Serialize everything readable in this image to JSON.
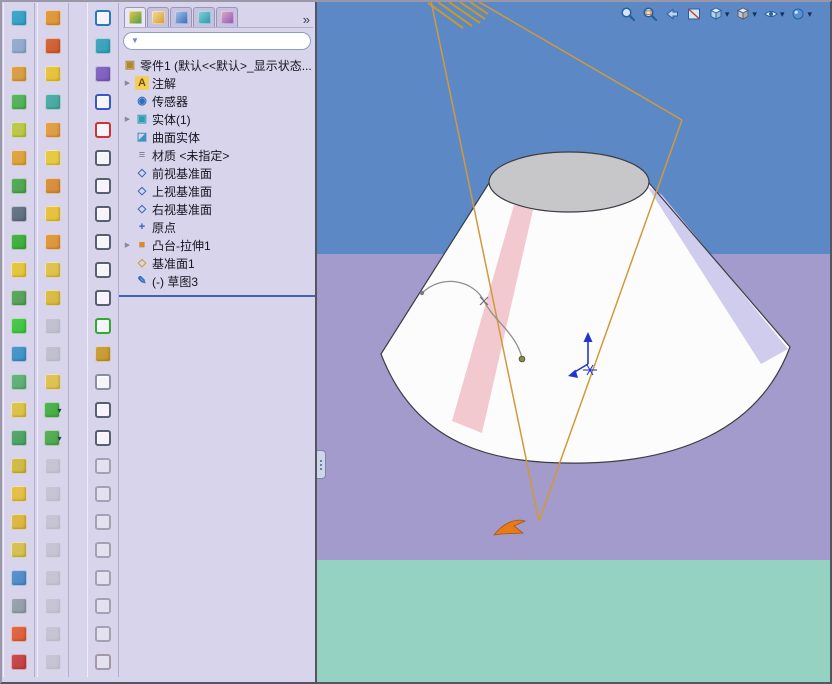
{
  "panel": {
    "overflow_chevron": "»",
    "tabs": [
      {
        "n": "featuremanager",
        "g": "linear-gradient(135deg,#e8c84a,#4c9a4c)"
      },
      {
        "n": "propertymanager",
        "g": "linear-gradient(135deg,#f0e0a0,#d89830)"
      },
      {
        "n": "configurationmanager",
        "g": "linear-gradient(135deg,#a8c4e8,#3868b8)"
      },
      {
        "n": "dimxpertmanager",
        "g": "linear-gradient(135deg,#88d0d8,#2898a8)"
      },
      {
        "n": "displaymanager",
        "g": "linear-gradient(135deg,#e8a8c0,#8858b8)"
      }
    ],
    "filter": {
      "value": "",
      "placeholder": ""
    },
    "tree": {
      "root": {
        "label": "零件1 (默认<<默认>_显示状态...",
        "glyph": "▣",
        "fg": "#b08828"
      },
      "items": [
        {
          "n": "annotations",
          "label": "注解",
          "glyph": "A",
          "fg": "#7a4c00",
          "bg": "#f2cf5a",
          "arrow": 1
        },
        {
          "n": "sensors",
          "label": "传感器",
          "glyph": "◉",
          "fg": "#2f6fc0"
        },
        {
          "n": "solid-bodies",
          "label": "实体(1)",
          "glyph": "▣",
          "fg": "#2f9fb0",
          "arrow": 1
        },
        {
          "n": "surface-bodies",
          "label": "曲面实体",
          "glyph": "◪",
          "fg": "#4090c0"
        },
        {
          "n": "material",
          "label": "材质 <未指定>",
          "glyph": "≡",
          "fg": "#6f7786"
        },
        {
          "n": "front-plane",
          "label": "前视基准面",
          "glyph": "◇",
          "fg": "#3868c0"
        },
        {
          "n": "top-plane",
          "label": "上视基准面",
          "glyph": "◇",
          "fg": "#3868c0"
        },
        {
          "n": "right-plane",
          "label": "右视基准面",
          "glyph": "◇",
          "fg": "#3868c0"
        },
        {
          "n": "origin",
          "label": "原点",
          "glyph": "+",
          "fg": "#2f5fc0"
        },
        {
          "n": "boss-extrude1",
          "label": "凸台-拉伸1",
          "glyph": "■",
          "fg": "#d98a2e",
          "arrow": 1
        },
        {
          "n": "plane1",
          "label": "基准面1",
          "glyph": "◇",
          "fg": "#c8a030"
        },
        {
          "n": "sketch3",
          "label": "(-) 草图3",
          "glyph": "✎",
          "fg": "#2f6fc0",
          "sel": 1
        }
      ]
    }
  },
  "toolbars": {
    "columns": [
      {
        "id": "standard",
        "icons": [
          [
            "new-part",
            "#2f9fc4",
            "f",
            0,
            0
          ],
          [
            "open",
            "#8fa8cc",
            "f",
            0,
            0
          ],
          [
            "save",
            "#d89a3c",
            "f",
            0,
            0
          ],
          [
            "extrude-boss",
            "#4caf50",
            "f",
            0,
            0
          ],
          [
            "revolve-boss",
            "#b9c83e",
            "f",
            0,
            0
          ],
          [
            "sweep",
            "#df9f33",
            "f",
            0,
            0
          ],
          [
            "loft",
            "#49a34b",
            "f",
            0,
            0
          ],
          [
            "delete-face",
            "#5c6b7d",
            "f",
            0,
            0
          ],
          [
            "extrude-cut",
            "#35ad35",
            "f",
            0,
            0
          ],
          [
            "revolve-cut",
            "#e5c433",
            "f",
            0,
            0
          ],
          [
            "sweep-cut",
            "#4f9f52",
            "f",
            0,
            0
          ],
          [
            "loft-cut",
            "#3bc43b",
            "f",
            0,
            0
          ],
          [
            "fillet",
            "#3b8fc6",
            "f",
            0,
            0
          ],
          [
            "chamfer",
            "#57ae6e",
            "f",
            0,
            0
          ],
          [
            "rib",
            "#dcc03e",
            "f",
            0,
            0
          ],
          [
            "shell",
            "#46a05f",
            "f",
            0,
            0
          ],
          [
            "draft",
            "#cfb93a",
            "f",
            0,
            0
          ],
          [
            "hole-wizard",
            "#e4bd3d",
            "f",
            0,
            0
          ],
          [
            "linear-pattern",
            "#ddb535",
            "f",
            0,
            0
          ],
          [
            "circular-pattern",
            "#d6bf49",
            "f",
            0,
            0
          ],
          [
            "mirror",
            "#4a89c8",
            "f",
            0,
            0
          ],
          [
            "reference-geometry",
            "#939ba9",
            "f",
            0,
            0
          ],
          [
            "curve",
            "#df5b33",
            "f",
            0,
            0
          ],
          [
            "instant3d",
            "#c43b3b",
            "f",
            0,
            0
          ]
        ]
      },
      {
        "id": "features",
        "icons": [
          [
            "boss-extrude",
            "#e09330",
            "f",
            0,
            0
          ],
          [
            "revolved-boss",
            "#d05a28",
            "f",
            0,
            0
          ],
          [
            "swept-boss",
            "#e8c231",
            "f",
            0,
            0
          ],
          [
            "lofted-boss",
            "#41a8a0",
            "f",
            0,
            0
          ],
          [
            "boundary-boss",
            "#e09a39",
            "f",
            0,
            0
          ],
          [
            "extruded-cut",
            "#e8c839",
            "f",
            0,
            0
          ],
          [
            "hole-wizard2",
            "#d88a31",
            "f",
            0,
            0
          ],
          [
            "revolved-cut",
            "#e8c132",
            "f",
            0,
            0
          ],
          [
            "swept-cut",
            "#e09231",
            "f",
            0,
            0
          ],
          [
            "lofted-cut",
            "#e0c141",
            "f",
            0,
            0
          ],
          [
            "boundary-cut",
            "#d9b939",
            "f",
            0,
            0
          ],
          [
            "fillet2",
            "#9aa2b4",
            "f",
            1,
            0
          ],
          [
            "chamfer2",
            "#9aa2b4",
            "f",
            1,
            0
          ],
          [
            "rib2",
            "#e0c148",
            "f",
            0,
            0
          ],
          [
            "curve-through-points",
            "#3fae3f",
            "f",
            0,
            1
          ],
          [
            "composite-curve",
            "#4aa84a",
            "f",
            0,
            1
          ],
          [
            "helix",
            "#a9abbb",
            "f",
            1,
            0
          ],
          [
            "reference-plane",
            "#a9abbb",
            "f",
            1,
            0
          ],
          [
            "axis",
            "#a9abbb",
            "f",
            1,
            0
          ],
          [
            "coordinate-system",
            "#a9abbb",
            "f",
            1,
            0
          ],
          [
            "point-ref",
            "#a9abbb",
            "f",
            1,
            0
          ],
          [
            "mate-reference",
            "#a9abbb",
            "f",
            1,
            0
          ],
          [
            "boundary-surface",
            "#a9abbb",
            "f",
            1,
            0
          ],
          [
            "surface-trim",
            "#a9abbb",
            "f",
            1,
            0
          ]
        ]
      },
      {
        "id": "sketch",
        "icons": [
          [
            "select-tool",
            "#2878c0",
            "l",
            0,
            0
          ],
          [
            "grid-settings",
            "#30a0b8",
            "f",
            0,
            0
          ],
          [
            "smart-dimension",
            "#7a5abc",
            "f",
            0,
            0
          ],
          [
            "line-tool",
            "#3858c8",
            "l",
            0,
            0
          ],
          [
            "rectangle-tool",
            "#cc3333",
            "l",
            0,
            0
          ],
          [
            "circle-tool",
            "#556070",
            "l",
            0,
            0
          ],
          [
            "perimeter-circle",
            "#556070",
            "l",
            0,
            0
          ],
          [
            "centerpoint-arc",
            "#556070",
            "l",
            0,
            0
          ],
          [
            "tangent-arc",
            "#556070",
            "l",
            0,
            0
          ],
          [
            "three-point-arc",
            "#556070",
            "l",
            0,
            0
          ],
          [
            "sketch-fillet",
            "#556070",
            "l",
            0,
            0
          ],
          [
            "spline-tool",
            "#2faa2f",
            "l",
            0,
            0
          ],
          [
            "point-tool",
            "#c89828",
            "f",
            0,
            0
          ],
          [
            "hatch-face",
            "#8890a0",
            "l",
            0,
            0
          ],
          [
            "mirror-entities",
            "#556070",
            "l",
            0,
            0
          ],
          [
            "offset-entities",
            "#556070",
            "l",
            0,
            0
          ],
          [
            "trim-entities",
            "#556070",
            "l",
            1,
            0
          ],
          [
            "convert-entities",
            "#556070",
            "l",
            1,
            0
          ],
          [
            "display-relations",
            "#556070",
            "l",
            1,
            0
          ],
          [
            "repair-sketch",
            "#556070",
            "l",
            1,
            0
          ],
          [
            "quick-snaps",
            "#556070",
            "l",
            1,
            0
          ],
          [
            "sketch-picture",
            "#556070",
            "l",
            1,
            0
          ],
          [
            "modify-sketch",
            "#556070",
            "l",
            1,
            0
          ],
          [
            "exit-sketch",
            "#b03030",
            "l",
            1,
            0
          ]
        ]
      }
    ]
  },
  "viewport": {
    "colors": {
      "sky": "#5d88c6",
      "horizon": "#a29bcb",
      "ground": "#95d2c2",
      "cone_body": "#fcfcfd",
      "cone_top": "#c7c7c9",
      "outline": "#3c3c44",
      "stripe_pink": "#f3c9d0",
      "stripe_lavender": "#d0ccee",
      "sketch_line": "#cf9a3a",
      "hatch": "#c39a2d",
      "spline": "#8f8f8f",
      "triad": "#2433cf",
      "dart": "#e87a18"
    },
    "hud": [
      {
        "n": "zoom-to-fit",
        "t": "mag",
        "caret": 0
      },
      {
        "n": "zoom-to-area",
        "t": "magarea",
        "caret": 0
      },
      {
        "n": "previous-view",
        "t": "prev",
        "caret": 0
      },
      {
        "n": "section-view",
        "t": "section",
        "caret": 0
      },
      {
        "n": "view-orientation",
        "t": "cube",
        "caret": 1
      },
      {
        "n": "display-style",
        "t": "cube2",
        "caret": 1
      },
      {
        "n": "hide-show-items",
        "t": "eye",
        "caret": 1
      },
      {
        "n": "edit-appearance",
        "t": "ball",
        "caret": 1
      }
    ]
  }
}
